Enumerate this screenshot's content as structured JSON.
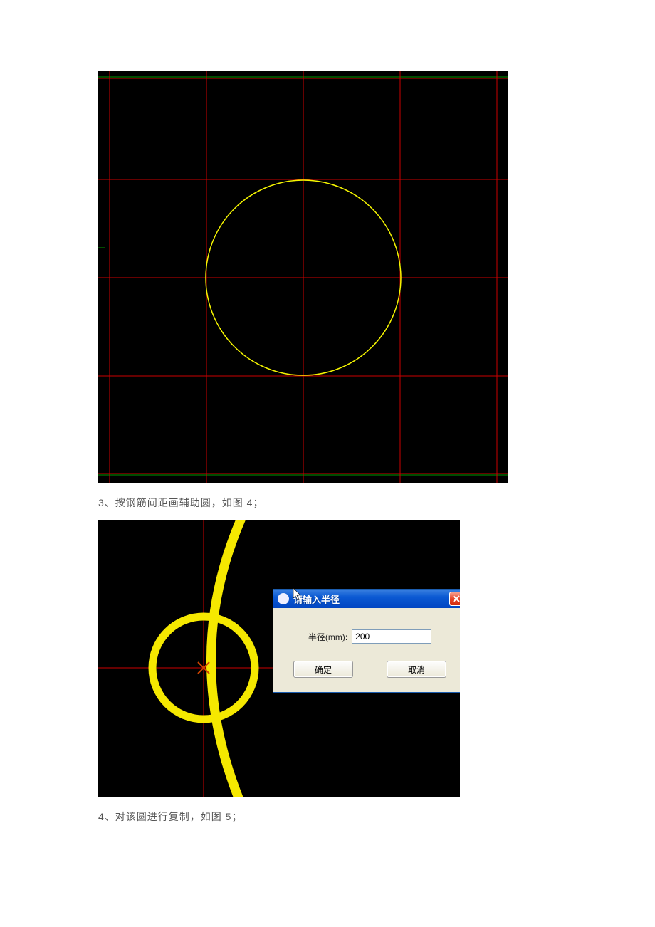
{
  "captions": {
    "step3": "3、按钢筋间距画辅助圆，如图 4；",
    "step4": "4、对该圆进行复制，如图 5；"
  },
  "dialog": {
    "title": "请输入半径",
    "field_label": "半径(mm):",
    "input_value": "200",
    "ok_label": "确定",
    "cancel_label": "取消",
    "close_name": "close-icon"
  },
  "figure1": {
    "grid_color": "#cc0000",
    "border_color": "#009900",
    "circle_color": "#f5f500"
  },
  "figure2": {
    "crosshair_color": "#cc0000",
    "circle_color": "#f5e800"
  }
}
